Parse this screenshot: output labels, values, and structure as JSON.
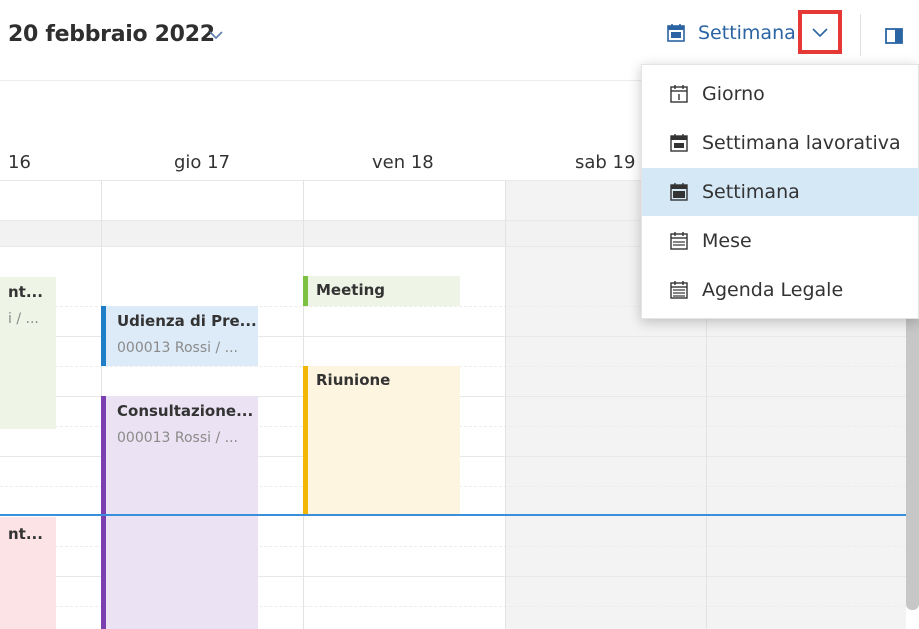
{
  "header": {
    "date_title": "20 febbraio 2022",
    "view_selected": "Settimana"
  },
  "days": [
    "16",
    "gio 17",
    "ven 18",
    "sab 19"
  ],
  "events": {
    "wed_top": {
      "title": "nt...",
      "sub": "i / ..."
    },
    "wed_bottom": {
      "title": "nt..."
    },
    "udienza": {
      "title": "Udienza di Pre...",
      "sub": "000013 Rossi / ..."
    },
    "consultazione": {
      "title": "Consultazione...",
      "sub": "000013 Rossi / ..."
    },
    "meeting": {
      "title": "Meeting"
    },
    "riunione": {
      "title": "Riunione"
    }
  },
  "menu": {
    "items": [
      {
        "label": "Giorno",
        "icon": "calendar-day-icon"
      },
      {
        "label": "Settimana lavorativa",
        "icon": "calendar-workweek-icon"
      },
      {
        "label": "Settimana",
        "icon": "calendar-week-icon",
        "selected": true
      },
      {
        "label": "Mese",
        "icon": "calendar-month-icon"
      },
      {
        "label": "Agenda Legale",
        "icon": "calendar-agenda-icon"
      }
    ]
  },
  "colors": {
    "accent": "#2b64a3",
    "highlight_border": "#e53935",
    "selected_bg": "#d5e8f6",
    "now_line": "#3a8fdb",
    "udienza_bar": "#1e7fc8",
    "consultazione_bar": "#7b3fb0",
    "meeting_bar": "#7cc242",
    "riunione_bar": "#f2b705"
  }
}
